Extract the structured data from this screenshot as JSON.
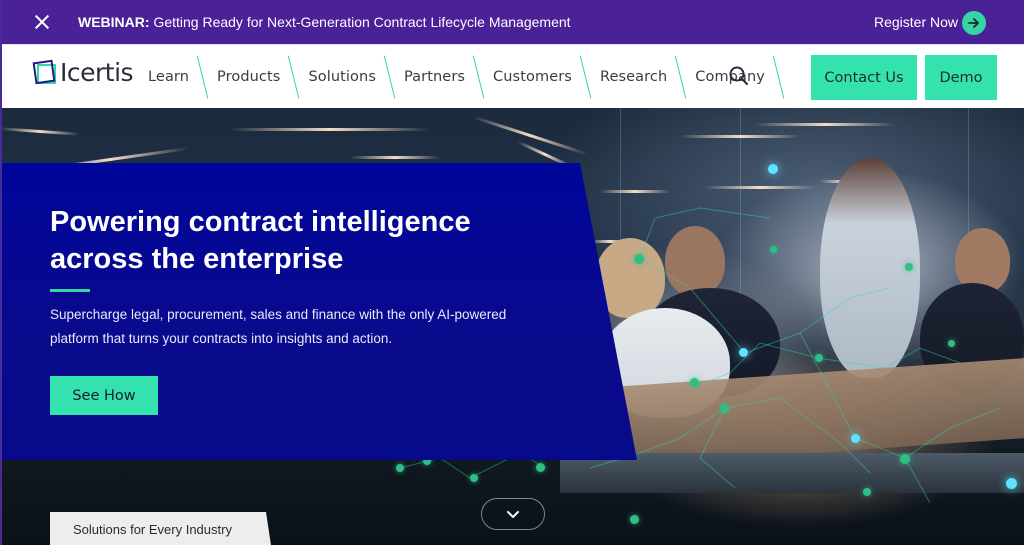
{
  "announcement": {
    "label": "WEBINAR:",
    "text": " Getting Ready for Next-Generation Contract Lifecycle Management",
    "cta": "Register Now",
    "close_icon": "close-icon",
    "arrow_icon": "arrow-right-icon"
  },
  "nav": {
    "logo_text": "Icertis",
    "items": [
      {
        "label": "Learn"
      },
      {
        "label": "Products"
      },
      {
        "label": "Solutions"
      },
      {
        "label": "Partners"
      },
      {
        "label": "Customers"
      },
      {
        "label": "Research"
      },
      {
        "label": "Company"
      }
    ],
    "search_icon": "search-icon",
    "contact_label": "Contact Us",
    "demo_label": "Demo"
  },
  "hero": {
    "title_line1": "Powering contract intelligence",
    "title_line2": "across the enterprise",
    "subtitle_line1": "Supercharge legal, procurement, sales and finance with the only AI-powered",
    "subtitle_line2": "platform that turns your contracts into insights and action.",
    "cta_label": "See How",
    "industry_tab_label": "Solutions for Every Industry",
    "scroll_icon": "chevron-down-icon"
  },
  "colors": {
    "announcement_bg": "#4a2196",
    "accent_green": "#34e2ad",
    "hero_panel_blue": "#00069a",
    "text_dark": "#3a3a48"
  }
}
